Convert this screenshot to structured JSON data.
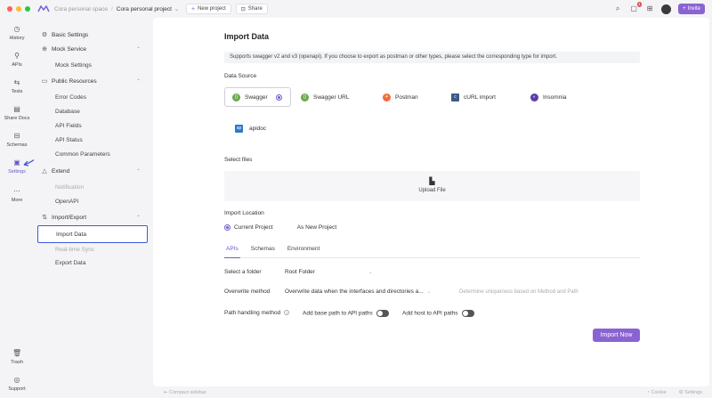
{
  "topbar": {
    "traffic_colors": [
      "#ff5f57",
      "#febc2e",
      "#28c840"
    ],
    "workspace": "Cora personal space",
    "project": "Cora personal project",
    "new_project_label": "New project",
    "share_label": "Share",
    "notification_count": "1",
    "invite_label": "Invite"
  },
  "rail": {
    "items": [
      {
        "label": "History",
        "icon": "clock-icon"
      },
      {
        "label": "APIs",
        "icon": "api-icon"
      },
      {
        "label": "Tests",
        "icon": "test-icon"
      },
      {
        "label": "Share Docs",
        "icon": "doc-icon"
      },
      {
        "label": "Schemas",
        "icon": "schema-icon"
      },
      {
        "label": "Settings",
        "icon": "settings-icon"
      },
      {
        "label": "More",
        "icon": "more-icon"
      },
      {
        "label": "Trash",
        "icon": "trash-icon"
      },
      {
        "label": "Support",
        "icon": "support-icon"
      }
    ]
  },
  "sidebar": {
    "basic_settings": "Basic Settings",
    "mock_service": "Mock Service",
    "mock_settings": "Mock Settings",
    "public_resources": "Public Resources",
    "error_codes": "Error Codes",
    "database": "Database",
    "api_fields": "API Fields",
    "api_status": "API Status",
    "common_parameters": "Common Parameters",
    "extend": "Extend",
    "notification": "Notification",
    "openapi": "OpenAPI",
    "import_export": "Import/Export",
    "import_data": "Import Data",
    "real_time_sync": "Real-time Sync",
    "export_data": "Export Data"
  },
  "main": {
    "title": "Import Data",
    "notice": "Supports swagger v2 and v3 (openapi). If you choose to export as postman or other types, please select the corresponding type for import.",
    "data_source_label": "Data Source",
    "sources": [
      {
        "label": "Swagger",
        "color": "#6aa84f",
        "icon": "swagger-icon"
      },
      {
        "label": "Swagger URL",
        "color": "#6aa84f",
        "icon": "swagger-url-icon"
      },
      {
        "label": "Postman",
        "color": "#ef6c3a",
        "icon": "postman-icon"
      },
      {
        "label": "cURL import",
        "color": "#3c5a8a",
        "icon": "curl-icon"
      },
      {
        "label": "Insomnia",
        "color": "#5b3ea8",
        "icon": "insomnia-icon"
      },
      {
        "label": "apidoc",
        "color": "#2a7ac9",
        "icon": "apidoc-icon"
      }
    ],
    "select_files_label": "Select files",
    "upload_label": "Upload File",
    "import_location_label": "Import Location",
    "current_project": "Current Project",
    "as_new_project": "As New Project",
    "tabs": [
      "APIs",
      "Schemas",
      "Environment"
    ],
    "select_folder_label": "Select a folder",
    "select_folder_value": "Root Folder",
    "overwrite_label": "Overwrite method",
    "overwrite_value": "Overwrite data when the interfaces and directories a...",
    "overwrite_hint": "Determine uniqueness based on Method and Path",
    "path_handling_label": "Path handling method",
    "add_base_path": "Add base path to API paths",
    "add_host": "Add host to API paths",
    "import_button": "Import Now"
  },
  "status": {
    "left": "Compact sidebar",
    "cookie": "Cookie",
    "settings": "Settings"
  }
}
